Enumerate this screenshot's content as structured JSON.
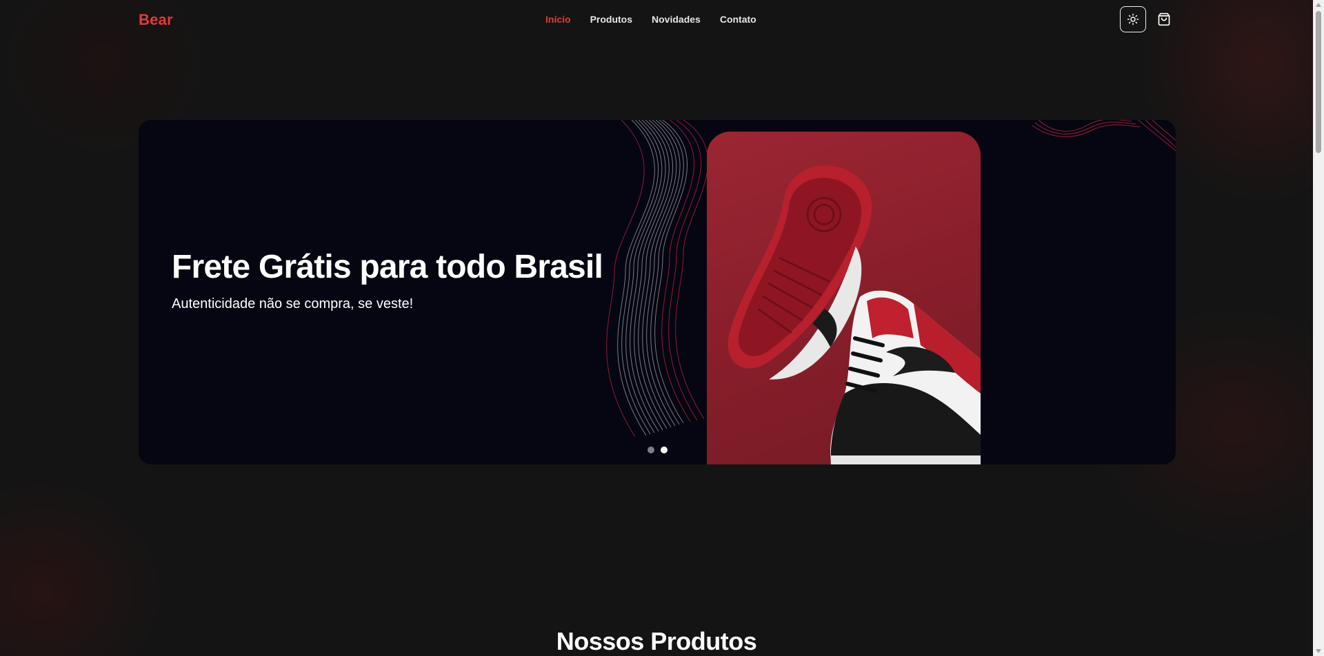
{
  "header": {
    "brand": "Bear",
    "nav": [
      {
        "label": "Início",
        "active": true
      },
      {
        "label": "Produtos",
        "active": false
      },
      {
        "label": "Novidades",
        "active": false
      },
      {
        "label": "Contato",
        "active": false
      }
    ],
    "theme_toggle_icon": "sun-icon",
    "cart_icon": "shopping-bag-icon"
  },
  "hero": {
    "title": "Frete Grátis para todo Brasil",
    "subtitle": "Autenticidade não se compra, se veste!",
    "image": "red-sneakers-photo",
    "slides_total": 2,
    "active_slide": 2
  },
  "section": {
    "title": "Nossos Produtos"
  },
  "colors": {
    "background": "#141414",
    "accent": "#e23b3b",
    "hero_background": "#050612",
    "card_red": "#8a1f2b"
  }
}
